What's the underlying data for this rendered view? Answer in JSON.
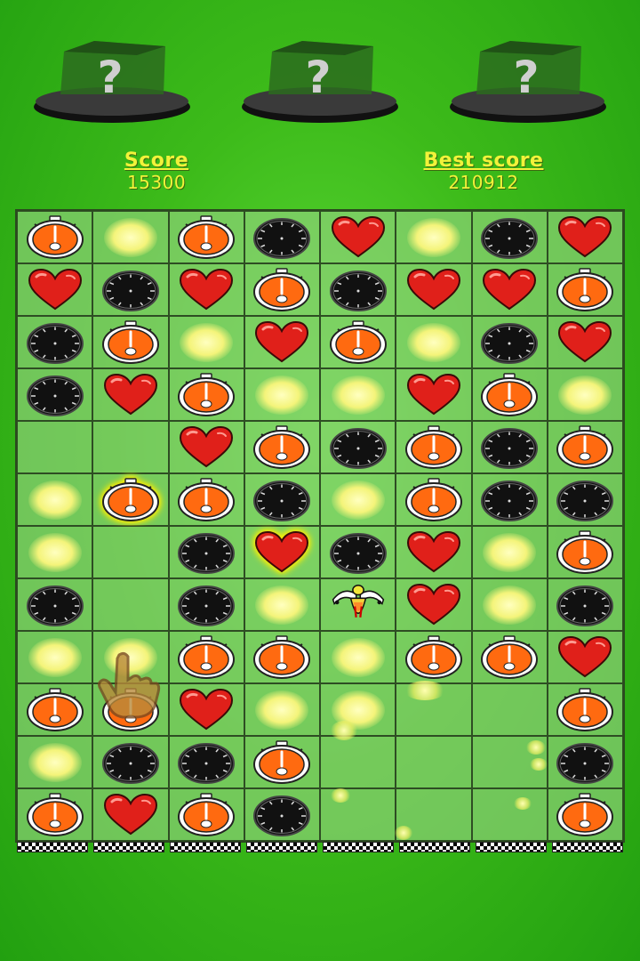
{
  "powerups": [
    {
      "label": "?"
    },
    {
      "label": "?"
    },
    {
      "label": "?"
    }
  ],
  "score": {
    "label": "Score",
    "value": "15300"
  },
  "best_score": {
    "label": "Best score",
    "value": "210912"
  },
  "board": {
    "columns": 8,
    "rows": [
      [
        "stopwatch",
        "glow",
        "stopwatch",
        "clock",
        "heart",
        "glow",
        "clock",
        "heart"
      ],
      [
        "heart",
        "clock",
        "heart",
        "stopwatch",
        "clock",
        "heart",
        "heart",
        "stopwatch"
      ],
      [
        "clock",
        "stopwatch",
        "glow",
        "heart",
        "stopwatch",
        "glow",
        "clock",
        "heart"
      ],
      [
        "clock",
        "heart",
        "stopwatch",
        "glow",
        "glow",
        "heart",
        "stopwatch",
        "glow"
      ],
      [
        "empty",
        "empty",
        "heart",
        "stopwatch",
        "clock",
        "stopwatch",
        "clock",
        "stopwatch"
      ],
      [
        "glow",
        "stopwatch-selected",
        "stopwatch",
        "clock",
        "glow",
        "stopwatch",
        "clock",
        "clock"
      ],
      [
        "glow",
        "empty",
        "clock",
        "heart-selected",
        "clock",
        "heart",
        "glow",
        "stopwatch"
      ],
      [
        "clock",
        "empty",
        "clock",
        "glow",
        "bee",
        "heart",
        "glow",
        "clock"
      ],
      [
        "glow",
        "glow",
        "stopwatch",
        "stopwatch",
        "glow",
        "stopwatch",
        "stopwatch",
        "heart"
      ],
      [
        "stopwatch",
        "stopwatch",
        "heart",
        "glow",
        "glow",
        "empty",
        "empty",
        "stopwatch"
      ],
      [
        "glow",
        "clock",
        "clock",
        "stopwatch",
        "empty",
        "empty",
        "empty",
        "clock"
      ],
      [
        "stopwatch",
        "heart",
        "stopwatch",
        "clock",
        "empty",
        "empty",
        "empty",
        "stopwatch"
      ]
    ]
  },
  "colors": {
    "heart": "#e0201a",
    "stopwatch_fill": "#ff6a10",
    "score_text": "#f2f23a",
    "background": "#3dbb1a"
  },
  "icons": {
    "powerup": "mystery-box-icon",
    "heart": "heart-icon",
    "stopwatch": "stopwatch-icon",
    "clock": "clock-icon",
    "bee": "bee-icon",
    "hand": "pointer-hand-icon"
  }
}
